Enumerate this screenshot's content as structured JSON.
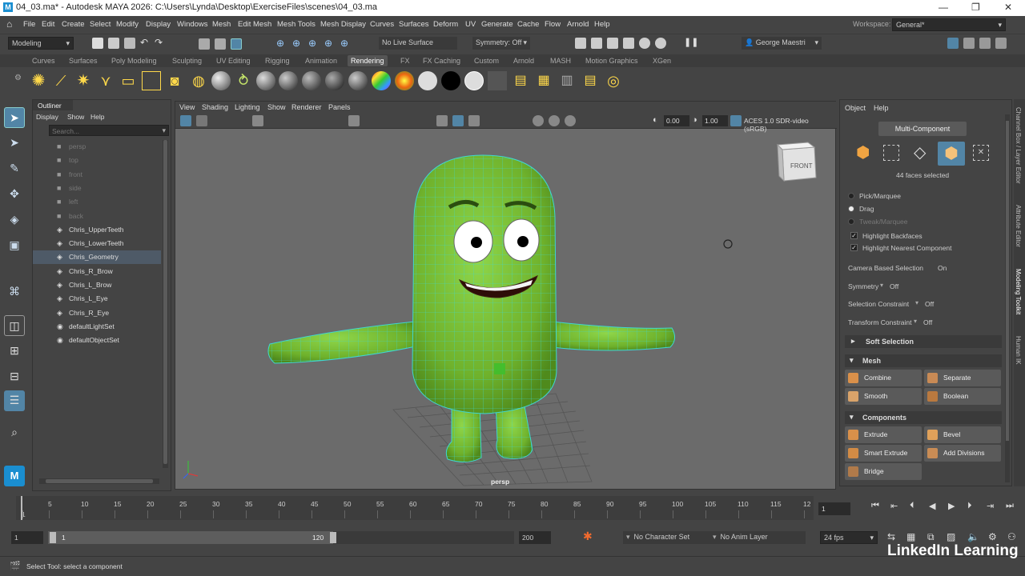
{
  "title": "04_03.ma* - Autodesk MAYA 2026: C:\\Users\\Lynda\\Desktop\\ExerciseFiles\\scenes\\04_03.ma",
  "logo_letter": "M",
  "menu": [
    "File",
    "Edit",
    "Create",
    "Select",
    "Modify",
    "Display",
    "Windows",
    "Mesh",
    "Edit Mesh",
    "Mesh Tools",
    "Mesh Display",
    "Curves",
    "Surfaces",
    "Deform",
    "UV",
    "Generate",
    "Cache",
    "Flow",
    "Arnold",
    "Help"
  ],
  "workspace": {
    "label": "Workspace:",
    "value": "General*"
  },
  "status": {
    "menuset": "Modeling",
    "live_surface": "No Live Surface",
    "symmetry": "Symmetry: Off",
    "user": "George Maestri"
  },
  "shelf_tabs": [
    "Curves",
    "Surfaces",
    "Poly Modeling",
    "Sculpting",
    "UV Editing",
    "Rigging",
    "Animation",
    "Rendering",
    "FX",
    "FX Caching",
    "Custom",
    "Arnold",
    "MASH",
    "Motion Graphics",
    "XGen"
  ],
  "active_shelf": "Rendering",
  "outliner": {
    "tab": "Outliner",
    "menu": [
      "Display",
      "Show",
      "Help"
    ],
    "search_placeholder": "Search...",
    "items": [
      {
        "label": "persp",
        "type": "camera",
        "dim": true
      },
      {
        "label": "top",
        "type": "camera",
        "dim": true
      },
      {
        "label": "front",
        "type": "camera",
        "dim": true
      },
      {
        "label": "side",
        "type": "camera",
        "dim": true
      },
      {
        "label": "left",
        "type": "camera",
        "dim": true
      },
      {
        "label": "back",
        "type": "camera",
        "dim": true
      },
      {
        "label": "Chris_UpperTeeth",
        "type": "mesh",
        "dim": false
      },
      {
        "label": "Chris_LowerTeeth",
        "type": "mesh",
        "dim": false
      },
      {
        "label": "Chris_Geometry",
        "type": "mesh",
        "dim": false,
        "selected": true
      },
      {
        "label": "Chris_R_Brow",
        "type": "mesh",
        "dim": false
      },
      {
        "label": "Chris_L_Brow",
        "type": "mesh",
        "dim": false
      },
      {
        "label": "Chris_L_Eye",
        "type": "mesh",
        "dim": false
      },
      {
        "label": "Chris_R_Eye",
        "type": "mesh",
        "dim": false
      },
      {
        "label": "defaultLightSet",
        "type": "set",
        "dim": false
      },
      {
        "label": "defaultObjectSet",
        "type": "set",
        "dim": false
      }
    ]
  },
  "viewport": {
    "menu": [
      "View",
      "Shading",
      "Lighting",
      "Show",
      "Renderer",
      "Panels"
    ],
    "exposure": "0.00",
    "gamma": "1.00",
    "colorspace": "ACES 1.0 SDR-video (sRGB)",
    "camera_label": "persp",
    "viewcube": "FRONT"
  },
  "modeling_toolkit": {
    "menu": [
      "Object",
      "Help"
    ],
    "mode": "Multi-Component",
    "selection_info": "44 faces selected",
    "pick_options": [
      {
        "label": "Pick/Marquee",
        "on": false,
        "dim": false
      },
      {
        "label": "Drag",
        "on": true,
        "dim": false
      },
      {
        "label": "Tweak/Marquee",
        "on": false,
        "dim": true
      }
    ],
    "checks": [
      "Highlight Backfaces",
      "Highlight Nearest Component"
    ],
    "props": [
      {
        "label": "Camera Based Selection",
        "value": "On"
      },
      {
        "label": "Symmetry",
        "value": "Off"
      },
      {
        "label": "Selection Constraint",
        "value": "Off"
      },
      {
        "label": "Transform Constraint",
        "value": "Off"
      }
    ],
    "soft_selection": "Soft Selection",
    "mesh_header": "Mesh",
    "mesh_buttons": [
      "Combine",
      "Separate",
      "Smooth",
      "Boolean"
    ],
    "components_header": "Components",
    "component_buttons": [
      "Extrude",
      "Bevel",
      "Smart Extrude",
      "Add Divisions",
      "Bridge"
    ]
  },
  "side_tabs": [
    "Channel Box / Layer Editor",
    "Attribute Editor",
    "Modeling Toolkit",
    "Human IK"
  ],
  "timeline": {
    "ticks": [
      "1",
      "5",
      "10",
      "15",
      "20",
      "25",
      "30",
      "35",
      "40",
      "45",
      "50",
      "55",
      "60",
      "65",
      "70",
      "75",
      "80",
      "85",
      "90",
      "95",
      "100",
      "105",
      "110",
      "115",
      "12"
    ],
    "current_frame": "1"
  },
  "range": {
    "start": "1",
    "inner_start": "1",
    "inner_end": "120",
    "end": "200",
    "character_set": "No Character Set",
    "anim_layer": "No Anim Layer",
    "fps": "24 fps"
  },
  "help_text": "Select Tool: select a component",
  "watermark": "LinkedIn Learning",
  "colors": {
    "accent": "#5285a6",
    "mesh_green": "#7cc23a",
    "wire": "#3fd7d0"
  }
}
